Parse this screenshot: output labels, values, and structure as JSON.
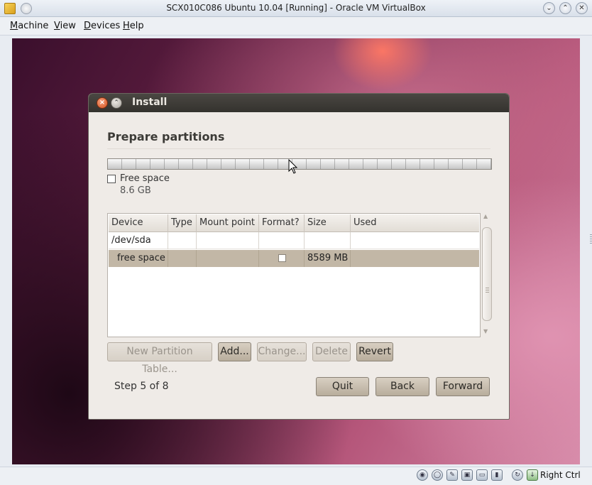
{
  "window": {
    "title": "SCX010C086 Ubuntu 10.04 [Running] - Oracle VM VirtualBox",
    "controls": [
      "minimize",
      "maximize",
      "close"
    ]
  },
  "menubar": {
    "items": [
      {
        "label": "Machine",
        "mnemonic": "M",
        "rest": "achine"
      },
      {
        "label": "View",
        "mnemonic": "V",
        "rest": "iew"
      },
      {
        "label": "Devices",
        "mnemonic": "D",
        "rest": "evices"
      },
      {
        "label": "Help",
        "mnemonic": "H",
        "rest": "elp"
      }
    ]
  },
  "install_dialog": {
    "title": "Install",
    "heading": "Prepare partitions",
    "partition_bar": {
      "legend_label": "Free space",
      "legend_size": "8.6 GB"
    },
    "table": {
      "columns": [
        "Device",
        "Type",
        "Mount point",
        "Format?",
        "Size",
        "Used"
      ],
      "rows": [
        {
          "device": "/dev/sda",
          "type": "",
          "mount": "",
          "format": "",
          "size": "",
          "used": ""
        },
        {
          "device": "free space",
          "type": "",
          "mount": "",
          "format": "checkbox",
          "size": "8589 MB",
          "used": "",
          "selected": true
        }
      ]
    },
    "table_buttons": {
      "new_partition_table": "New Partition Table...",
      "add": "Add...",
      "change": "Change...",
      "delete": "Delete",
      "revert": "Revert"
    },
    "step_text": "Step 5 of 8",
    "nav_buttons": {
      "quit": "Quit",
      "back": "Back",
      "forward": "Forward"
    }
  },
  "statusbar": {
    "icons": [
      "hard-disk-icon",
      "optical-disk-icon",
      "usb-icon",
      "network-icon",
      "shared-folder-icon",
      "display-icon",
      "mouse-integration-icon",
      "host-key-icon"
    ],
    "host_key_label": "Right Ctrl"
  },
  "colors": {
    "dialog_bg": "#efebe7",
    "titlebar_dark": "#3c3b37",
    "selected_row": "#c2b7a6",
    "button": "#c8bfb0",
    "close_button": "#e06a35"
  }
}
